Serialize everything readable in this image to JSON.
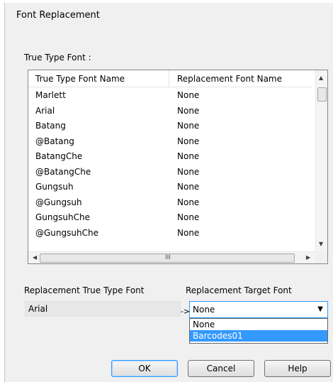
{
  "dialog": {
    "title": "Font Replacement"
  },
  "group": {
    "label": "True Type Font :"
  },
  "listview": {
    "columns": [
      "True Type Font Name",
      "Replacement Font Name"
    ],
    "rows": [
      [
        "Marlett",
        "None"
      ],
      [
        "Arial",
        "None"
      ],
      [
        "Batang",
        "None"
      ],
      [
        "@Batang",
        "None"
      ],
      [
        "BatangChe",
        "None"
      ],
      [
        "@BatangChe",
        "None"
      ],
      [
        "Gungsuh",
        "None"
      ],
      [
        "@Gungsuh",
        "None"
      ],
      [
        "GungsuhChe",
        "None"
      ],
      [
        "@GungsuhChe",
        "None"
      ]
    ],
    "hscroll_grip": "III"
  },
  "replacement": {
    "source_label": "Replacement True Type Font",
    "source_value": "Arial",
    "arrow": "->",
    "target_label": "Replacement Target Font",
    "target_value": "None",
    "options": [
      "None",
      "Barcodes01"
    ]
  },
  "buttons": {
    "ok": "OK",
    "cancel": "Cancel",
    "help": "Help"
  }
}
